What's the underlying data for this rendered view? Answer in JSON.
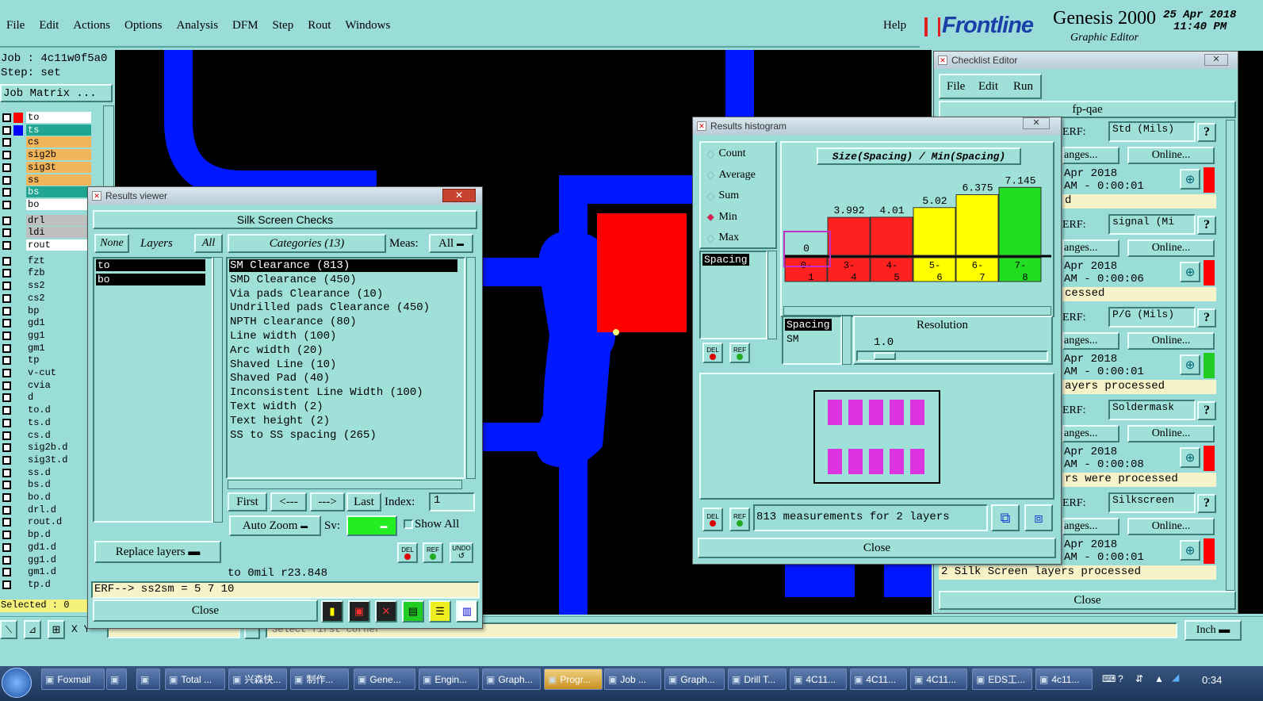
{
  "menubar": {
    "items": [
      "File",
      "Edit",
      "Actions",
      "Options",
      "Analysis",
      "DFM",
      "Step",
      "Rout",
      "Windows"
    ],
    "help": "Help"
  },
  "brand": {
    "logo": "Frontline",
    "product": "Genesis 2000",
    "subtitle": "Graphic Editor",
    "date": "25 Apr 2018",
    "time": "11:40 PM"
  },
  "job": {
    "job_label": "Job : 4c11w0f5a0",
    "step_label": "Step: set",
    "matrix_button": "Job Matrix ..."
  },
  "layers": [
    {
      "name": "to",
      "color": "#ffffff",
      "mark": "#ff0000"
    },
    {
      "name": "ts",
      "color": "#1fa590",
      "mark": "#0000ff"
    },
    {
      "name": "cs",
      "color": "#f2b55a"
    },
    {
      "name": "sig2b",
      "color": "#f2b55a"
    },
    {
      "name": "sig3t",
      "color": "#f2b55a"
    },
    {
      "name": "ss",
      "color": "#f2b55a"
    },
    {
      "name": "bs",
      "color": "#1fa590"
    },
    {
      "name": "bo",
      "color": "#ffffff"
    },
    {
      "name": "drl",
      "color": "#bfbfbf"
    },
    {
      "name": "ldi",
      "color": "#bfbfbf"
    },
    {
      "name": "rout",
      "color": "#ffffff"
    },
    {
      "name": "fzt"
    },
    {
      "name": "fzb"
    },
    {
      "name": "ss2"
    },
    {
      "name": "cs2"
    },
    {
      "name": "bp"
    },
    {
      "name": "gd1"
    },
    {
      "name": "gg1"
    },
    {
      "name": "gm1"
    },
    {
      "name": "tp"
    },
    {
      "name": "v-cut"
    },
    {
      "name": "cvia"
    },
    {
      "name": "d"
    },
    {
      "name": "to.d"
    },
    {
      "name": "ts.d"
    },
    {
      "name": "cs.d"
    },
    {
      "name": "sig2b.d"
    },
    {
      "name": "sig3t.d"
    },
    {
      "name": "ss.d"
    },
    {
      "name": "bs.d"
    },
    {
      "name": "bo.d"
    },
    {
      "name": "drl.d"
    },
    {
      "name": "rout.d"
    },
    {
      "name": "bp.d"
    },
    {
      "name": "gd1.d"
    },
    {
      "name": "gg1.d"
    },
    {
      "name": "gm1.d"
    },
    {
      "name": "tp.d"
    }
  ],
  "selected_label": "Selected : 0",
  "coords": {
    "label": "X Y"
  },
  "status_text": "Select first corner",
  "units": "Inch",
  "results_viewer": {
    "title": "Results viewer",
    "header": "Silk Screen Checks",
    "none_btn": "None",
    "layers_label": "Layers",
    "all_btn": "All",
    "layer_list": [
      "to",
      "bo"
    ],
    "categories_label": "Categories (13)",
    "meas_label": "Meas:",
    "meas_value": "All",
    "categories": [
      "SM Clearance (813)",
      "SMD Clearance (450)",
      "Via pads Clearance (10)",
      "Undrilled pads Clearance (450)",
      "NPTH clearance (80)",
      "Line width (100)",
      "Arc width (20)",
      "Shaved Line (10)",
      "Shaved Pad (40)",
      "Inconsistent Line Width (100)",
      "Text width (2)",
      "Text height (2)",
      "SS to SS spacing (265)"
    ],
    "nav": {
      "first": "First",
      "prev": "<---",
      "next": "--->",
      "last": "Last",
      "index_label": "Index:",
      "index_value": "1"
    },
    "auto_zoom": "Auto Zoom",
    "sv_label": "Sv:",
    "show_all": "Show All",
    "replace_layers": "Replace layers",
    "del": "DEL",
    "ref": "REF",
    "undo": "UNDO",
    "info": "to 0mil  r23.848",
    "erf": "ERF--> ss2sm = 5 7 10",
    "close": "Close"
  },
  "histogram": {
    "title": "Results histogram",
    "options": [
      "Count",
      "Average",
      "Sum",
      "Min",
      "Max"
    ],
    "selected_option": "Min",
    "chart_title": "Size(Spacing) / Min(Spacing)",
    "list_item": "Spacing",
    "sel1": "Spacing",
    "sel2": "SM",
    "resolution_label": "Resolution",
    "resolution_value": "1.0",
    "summary": "813 measurements for 2 layers",
    "close": "Close",
    "del": "DEL",
    "ref": "REF"
  },
  "chart_data": {
    "type": "bar",
    "title": "Size(Spacing) / Min(Spacing)",
    "categories": [
      "0-1",
      "3-4",
      "4-5",
      "5-6",
      "6-7",
      "7-8"
    ],
    "values": [
      0,
      3.992,
      4.01,
      5.02,
      6.375,
      7.145
    ],
    "labels": [
      "0",
      "3.992",
      "4.01",
      "5.02",
      "6.375",
      "7.145"
    ],
    "colors": [
      "#ff2020",
      "#ff2020",
      "#ff2020",
      "#ffff00",
      "#ffff00",
      "#22dd22"
    ]
  },
  "checklist": {
    "title": "Checklist Editor",
    "menu": [
      "File",
      "Edit",
      "Run"
    ],
    "name": "fp-qae",
    "rows": [
      {
        "erf": "Std (Mils)",
        "date": "Apr 2018",
        "time": "AM - 0:00:01",
        "status": "d",
        "flag": "#ff0000"
      },
      {
        "erf": "signal (Mi",
        "date": "Apr 2018",
        "time": "AM - 0:00:06",
        "status": "cessed",
        "flag": "#ff0000"
      },
      {
        "erf": "P/G (Mils)",
        "date": "Apr 2018",
        "time": "AM - 0:00:01",
        "status": "ayers processed",
        "flag": "#22cc22"
      },
      {
        "erf": "Soldermask",
        "date": "Apr 2018",
        "time": "AM - 0:00:08",
        "status": "rs were processed",
        "flag": "#ff0000"
      },
      {
        "erf": "Silkscreen",
        "date": "Apr 2018",
        "time": "AM - 0:00:01",
        "status": "2 Silk Screen layers processed",
        "flag": "#ff0000"
      }
    ],
    "erf_label": "ERF:",
    "ranges_label": "anges...",
    "online_label": "Online...",
    "q": "?",
    "close": "Close"
  },
  "taskbar": {
    "items": [
      "Foxmail",
      "",
      "",
      "Total ...",
      "兴森快...",
      "制作...",
      "Gene...",
      "Engin...",
      "Graph...",
      "Progr...",
      "Job ...",
      "Graph...",
      "Drill T...",
      "4C11...",
      "4C11...",
      "4C11...",
      "EDS工...",
      "4c11..."
    ],
    "clock": "0:34"
  }
}
